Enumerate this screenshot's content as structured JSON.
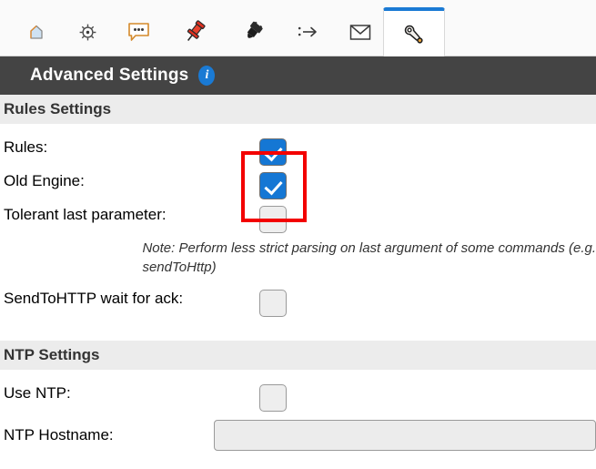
{
  "tabs": [
    {
      "name": "tab-home",
      "icon": "home-icon",
      "active": false
    },
    {
      "name": "tab-settings",
      "icon": "gear-icon",
      "active": false
    },
    {
      "name": "tab-messages",
      "icon": "speech-bubble-icon",
      "active": false
    },
    {
      "name": "tab-pinned",
      "icon": "pushpin-icon",
      "active": false
    },
    {
      "name": "tab-plug",
      "icon": "power-plug-icon",
      "active": false
    },
    {
      "name": "tab-forward",
      "icon": "arrow-right-icon",
      "active": false
    },
    {
      "name": "tab-mail",
      "icon": "envelope-icon",
      "active": false
    },
    {
      "name": "tab-tools",
      "icon": "wrench-icon",
      "active": true
    }
  ],
  "header": {
    "title": "Advanced Settings",
    "info_glyph": "i"
  },
  "sections": [
    {
      "heading": "Rules Settings",
      "rows": [
        {
          "label": "Rules:",
          "control": "checkbox",
          "checked": true
        },
        {
          "label": "Old Engine:",
          "control": "checkbox",
          "checked": true
        },
        {
          "label": "Tolerant last parameter:",
          "control": "checkbox",
          "checked": false
        },
        {
          "label": "",
          "control": "note",
          "note_line1": "Note: Perform less strict parsing on last argument of some commands (e.g.",
          "note_line2": "sendToHttp)"
        },
        {
          "label": "SendToHTTP wait for ack:",
          "control": "checkbox",
          "checked": false
        }
      ]
    },
    {
      "heading": "NTP Settings",
      "rows": [
        {
          "label": "Use NTP:",
          "control": "checkbox",
          "checked": false
        },
        {
          "label": "NTP Hostname:",
          "control": "text",
          "value": "",
          "placeholder": ""
        }
      ]
    }
  ],
  "annotation": {
    "name": "red-highlight-rectangle",
    "color": "#f30000",
    "surrounds": [
      "Rules checkbox",
      "Old Engine checkbox"
    ]
  },
  "colors": {
    "titlebar_bg": "#444444",
    "section_bg": "#ececec",
    "checkbox_checked": "#1577d4",
    "active_tab_accent": "#1a7ad4",
    "highlight": "#f30000"
  }
}
